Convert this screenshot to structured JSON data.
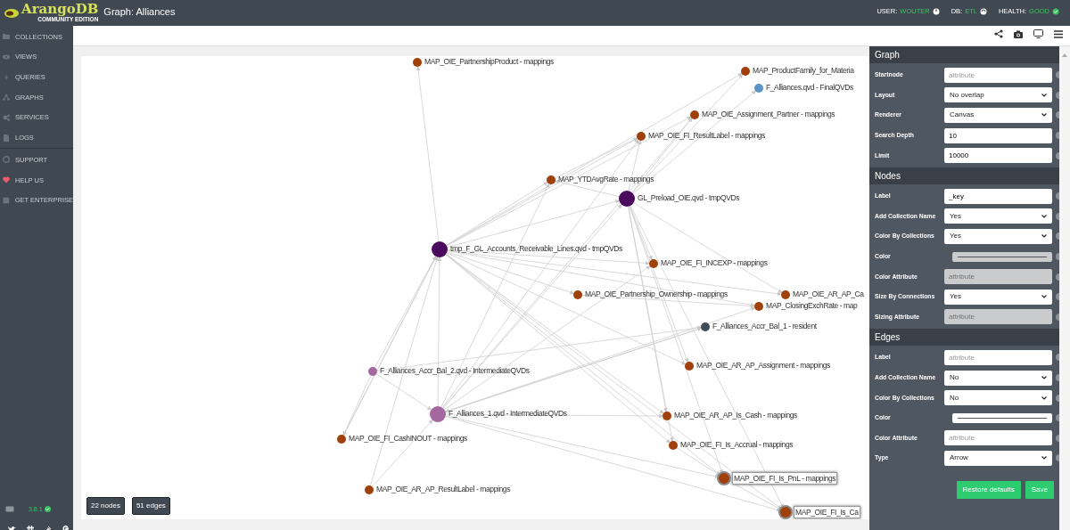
{
  "top_bar": {
    "logo": "ArangoDB",
    "edition": "COMMUNITY EDITION",
    "title": "Graph: Alliances",
    "status": [
      {
        "label": "USER:",
        "value": "WOUTER"
      },
      {
        "label": "DB:",
        "value": "ETL"
      },
      {
        "label": "HEALTH:",
        "value": "GOOD"
      }
    ]
  },
  "sidebar": {
    "groups": [
      [
        {
          "label": "COLLECTIONS"
        },
        {
          "label": "VIEWS"
        },
        {
          "label": "QUERIES"
        },
        {
          "label": "GRAPHS"
        },
        {
          "label": "SERVICES"
        },
        {
          "label": "LOGS"
        }
      ],
      [
        {
          "label": "SUPPORT"
        },
        {
          "label": "HELP US"
        },
        {
          "label": "GET ENTERPRISE"
        }
      ]
    ],
    "version": "3.8.1"
  },
  "graph": {
    "nodes": [
      {
        "label": "MAP_OIE_PartnershipProduct - mappings",
        "color": "#a0410c",
        "selected": false
      },
      {
        "label": "MAP_ProductFamily_for_Materia",
        "color": "#a0410c",
        "selected": false
      },
      {
        "label": "F_Alliances.qvd - FinalQVDs",
        "color": "#5b93c7",
        "selected": false
      },
      {
        "label": "MAP_OIE_Assignment_Partner - mappings",
        "color": "#a0410c",
        "selected": false
      },
      {
        "label": "MAP_OIE_FI_ResultLabel - mappings",
        "color": "#a0410c",
        "selected": false
      },
      {
        "label": "MAP_YTDAvgRate - mappings",
        "color": "#a0410c",
        "selected": false
      },
      {
        "label": "GL_Preload_OIE.qvd - tmpQVDs",
        "color": "#4c0a5e",
        "selected": false
      },
      {
        "label": "tmp_F_GL_Accounts_Receivable_Lines.qvd - tmpQVDs",
        "color": "#4c0a5e",
        "selected": false
      },
      {
        "label": "MAP_OIE_FI_INCEXP - mappings",
        "color": "#a0410c",
        "selected": false
      },
      {
        "label": "MAP_OIE_Partnership_Ownership - mappings",
        "color": "#a0410c",
        "selected": false
      },
      {
        "label": "MAP_OIE_AR_AP_Ca",
        "color": "#a0410c",
        "selected": false
      },
      {
        "label": "MAP_ClosingExchRate - map",
        "color": "#a0410c",
        "selected": false
      },
      {
        "label": "F_Alliances_Accr_Bal_1 - resident",
        "color": "#414b5a",
        "selected": false
      },
      {
        "label": "F_Alliances_Accr_Bal_2.qvd - IntermediateQVDs",
        "color": "#a5679f",
        "selected": false
      },
      {
        "label": "MAP_OIE_AR_AP_Assignment - mappings",
        "color": "#a0410c",
        "selected": false
      },
      {
        "label": "F_Alliances_1.qvd - IntermediateQVDs",
        "color": "#a5679f",
        "selected": false
      },
      {
        "label": "MAP_OIE_AR_AP_Is_Cash - mappings",
        "color": "#a0410c",
        "selected": false
      },
      {
        "label": "MAP_OIE_FI_CashINOUT - mappings",
        "color": "#a0410c",
        "selected": false
      },
      {
        "label": "MAP_OIE_FI_Is_Accrual - mappings",
        "color": "#a0410c",
        "selected": false
      },
      {
        "label": "MAP_OIE_FI_Is_PnL - mappings",
        "color": "#a0410c",
        "selected": true
      },
      {
        "label": "MAP_OIE_AR_AP_ResultLabel - mappings",
        "color": "#a0410c",
        "selected": false
      },
      {
        "label": "MAP_OIE_FI_Is_Ca",
        "color": "#a0410c",
        "selected": true
      }
    ],
    "counts": [
      "22 nodes",
      "51 edges"
    ]
  },
  "settings": {
    "sections": [
      {
        "title": "Graph",
        "fields": [
          {
            "label": "Startnode",
            "kind": "input",
            "placeholder": "attribute",
            "disabled": false
          },
          {
            "label": "Layout",
            "kind": "select",
            "value": "No overlap"
          },
          {
            "label": "Renderer",
            "kind": "select",
            "value": "Canvas"
          },
          {
            "label": "Search Depth",
            "kind": "input",
            "value": "10",
            "disabled": false
          },
          {
            "label": "Limit",
            "kind": "input",
            "value": "10000",
            "disabled": false
          }
        ]
      },
      {
        "title": "Nodes",
        "fields": [
          {
            "label": "Label",
            "kind": "input",
            "value": "_key",
            "disabled": false
          },
          {
            "label": "Add Collection Name",
            "kind": "select",
            "value": "Yes"
          },
          {
            "label": "Color By Collections",
            "kind": "select",
            "value": "Yes"
          },
          {
            "label": "Color",
            "kind": "color",
            "disabled": true
          },
          {
            "label": "Color Attribute",
            "kind": "input",
            "placeholder": "attribute",
            "disabled": true
          },
          {
            "label": "Size By Connections",
            "kind": "select",
            "value": "Yes"
          },
          {
            "label": "Sizing Attribute",
            "kind": "input",
            "placeholder": "attribute",
            "disabled": true
          }
        ]
      },
      {
        "title": "Edges",
        "fields": [
          {
            "label": "Label",
            "kind": "input",
            "placeholder": "attribute",
            "disabled": false
          },
          {
            "label": "Add Collection Name",
            "kind": "select",
            "value": "No"
          },
          {
            "label": "Color By Collections",
            "kind": "select",
            "value": "No"
          },
          {
            "label": "Color",
            "kind": "color",
            "disabled": false
          },
          {
            "label": "Color Attribute",
            "kind": "input",
            "placeholder": "attribute",
            "disabled": false
          },
          {
            "label": "Type",
            "kind": "select",
            "value": "Arrow"
          }
        ]
      }
    ],
    "buttons": [
      "Restore defaults",
      "Save"
    ]
  }
}
